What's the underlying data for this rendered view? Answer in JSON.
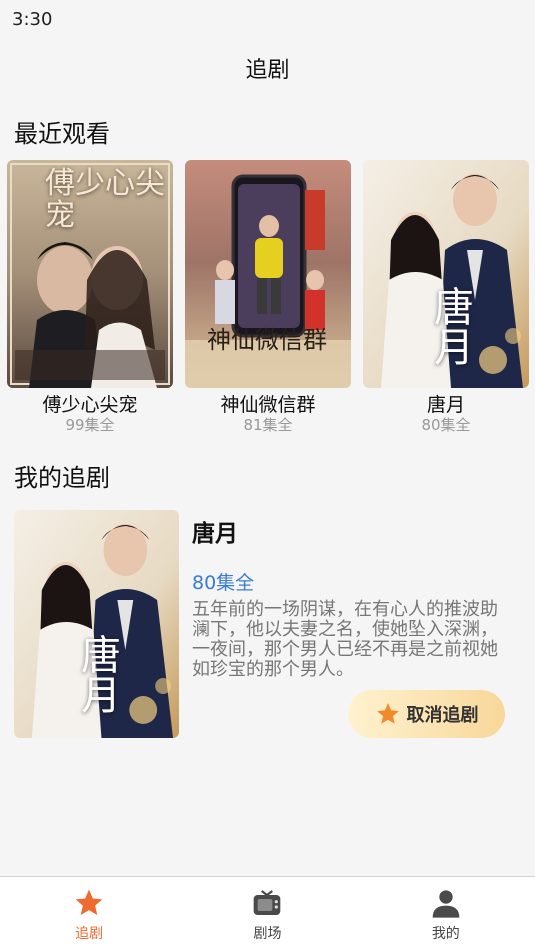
{
  "status": {
    "time": "3:30"
  },
  "header": {
    "title": "追剧"
  },
  "recent": {
    "title": "最近观看",
    "items": [
      {
        "name": "傅少心尖宠",
        "count": "99集全",
        "poster_text": "傅少心尖宠"
      },
      {
        "name": "神仙微信群",
        "count": "81集全",
        "poster_text": "神仙微信群"
      },
      {
        "name": "唐月",
        "count": "80集全",
        "poster_text": "唐月"
      }
    ]
  },
  "favorites": {
    "title": "我的追剧",
    "items": [
      {
        "name": "唐月",
        "count": "80集全",
        "poster_text": "唐月",
        "description": "五年前的一场阴谋，在有心人的推波助澜下，他以夫妻之名，使她坠入深渊，一夜间，那个男人已经不再是之前视她如珍宝的那个男人。",
        "unfollow_label": "取消追剧"
      }
    ]
  },
  "tabbar": {
    "items": [
      {
        "label": "追剧",
        "icon": "star-icon",
        "active": true
      },
      {
        "label": "剧场",
        "icon": "tv-icon",
        "active": false
      },
      {
        "label": "我的",
        "icon": "user-icon",
        "active": false
      }
    ]
  },
  "colors": {
    "accent": "#ef6a2f",
    "link": "#3a7bd5",
    "button_start": "#fff2cf",
    "button_end": "#f8d79a"
  }
}
